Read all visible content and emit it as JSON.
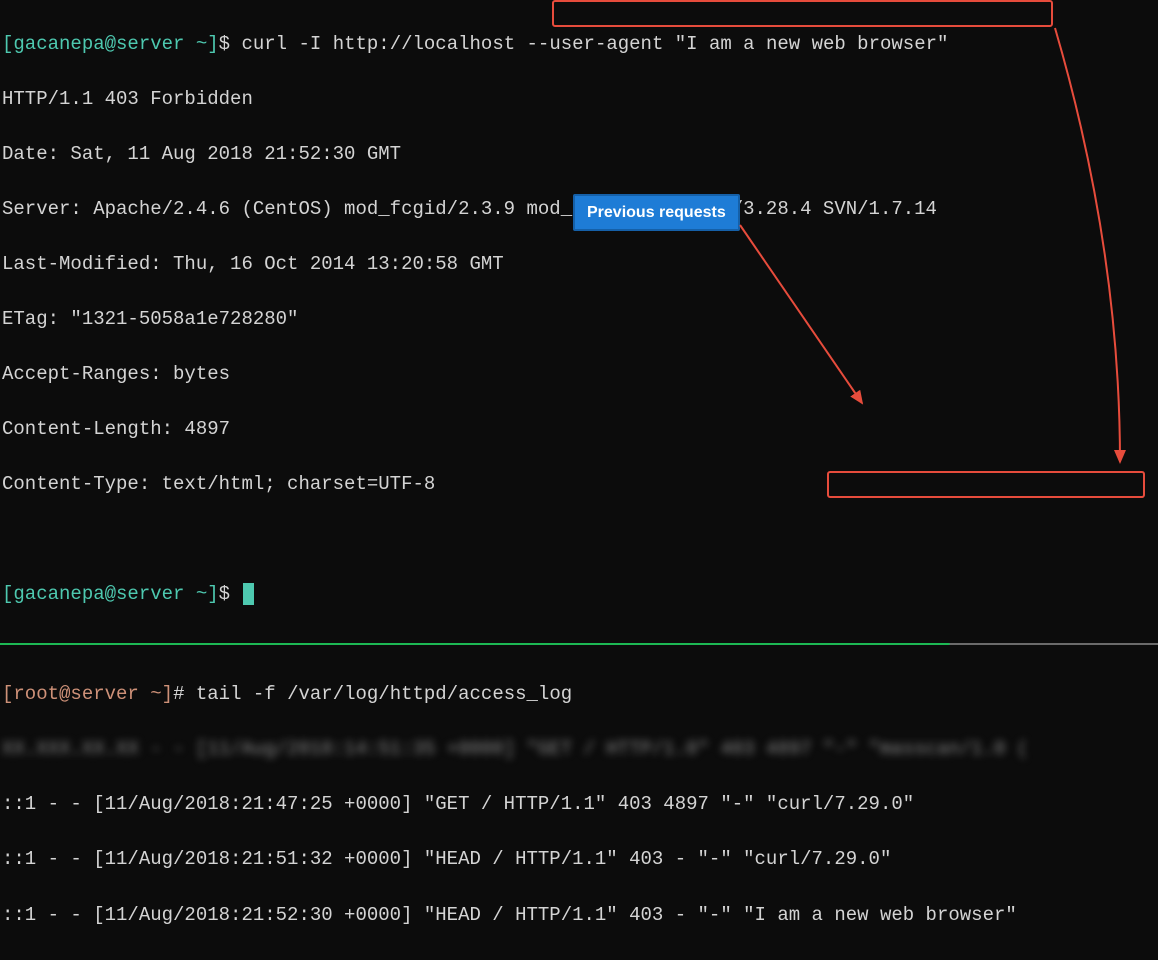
{
  "top_terminal": {
    "prompt": {
      "open": "[",
      "user": "gacanepa",
      "at": "@",
      "host": "server",
      "path": " ~",
      "close": "]",
      "symbol": "$"
    },
    "command": {
      "cmd_part1": " curl -I http://localhost ",
      "cmd_part2": "--user-agent \"I am a new web browser\""
    },
    "output_lines": [
      "HTTP/1.1 403 Forbidden",
      "Date: Sat, 11 Aug 2018 21:52:30 GMT",
      "Server: Apache/2.4.6 (CentOS) mod_fcgid/2.3.9 mod_nss/1.0.14 NSS/3.28.4 SVN/1.7.14",
      "Last-Modified: Thu, 16 Oct 2014 13:20:58 GMT",
      "ETag: \"1321-5058a1e728280\"",
      "Accept-Ranges: bytes",
      "Content-Length: 4897",
      "Content-Type: text/html; charset=UTF-8"
    ],
    "prompt2": {
      "open": "[",
      "user": "gacanepa",
      "at": "@",
      "host": "server",
      "path": " ~",
      "close": "]",
      "symbol": "$"
    }
  },
  "bottom_terminal": {
    "prompt": {
      "open": "[",
      "user": "root",
      "at": "@",
      "host": "server",
      "path": " ~",
      "close": "]",
      "symbol": "#"
    },
    "command": " tail -f /var/log/httpd/access_log",
    "blurred_line": "XX.XXX.XX.XX - - [11/Aug/2018:14:51:35 +0000] \"GET / HTTP/1.0\" 403 4897 \"-\" \"masscan/1.0 (",
    "log_lines": [
      {
        "left": "::1 - - [11/Aug/2018:21:47:25 +0000] \"GET / HTTP/1.1\" 403 4897 \"-\" \"curl/7.29.0\""
      },
      {
        "left": "::1 - - [11/Aug/2018:21:51:32 +0000] \"HEAD / HTTP/1.1\" 403 - \"-\" \"curl/7.29.0\""
      },
      {
        "left": "::1 - - [11/Aug/2018:21:52:30 +0000] \"HEAD / HTTP/1.1\" 403 - \"-\" ",
        "boxed": "\"I am a new web browser\""
      }
    ]
  },
  "annotations": {
    "label": "Previous requests"
  }
}
